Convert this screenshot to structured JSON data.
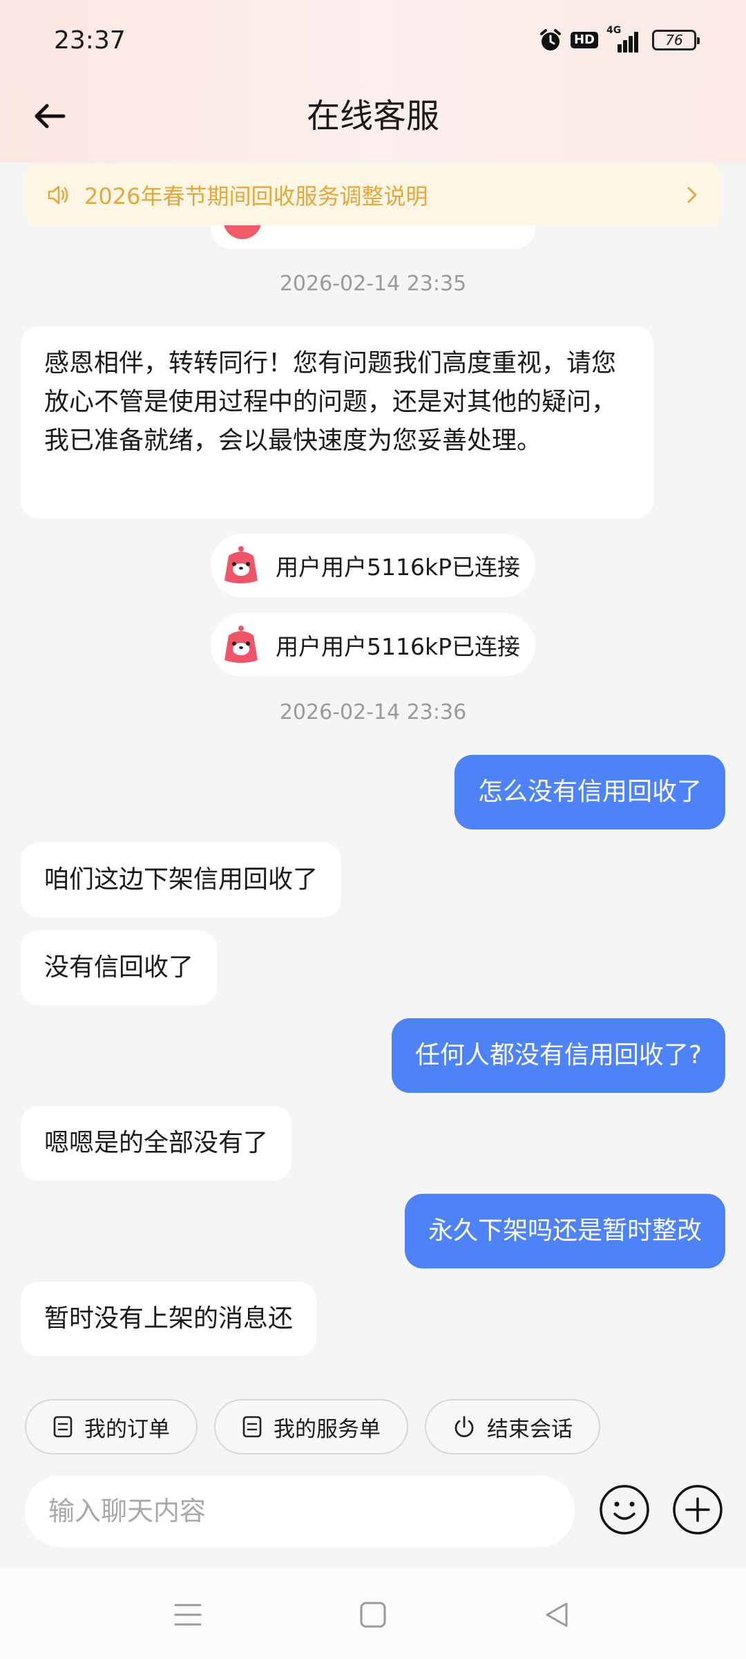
{
  "status_bar": {
    "time": "23:37",
    "hd": "HD",
    "network": "4G",
    "battery": "76"
  },
  "header": {
    "title": "在线客服",
    "back_icon": "arrow-left-icon"
  },
  "notice": {
    "text": "2026年春节期间回收服务调整说明",
    "icon": "speaker-icon"
  },
  "chat": {
    "timestamp_1": "2026-02-14 23:35",
    "agent_welcome": "感恩相伴，转转同行！您有问题我们高度重视，请您放心不管是使用过程中的问题，还是对其他的疑问，我已准备就绪，会以最快速度为您妥善处理。",
    "system_1": "用户用户5116kP已连接",
    "system_2": "用户用户5116kP已连接",
    "timestamp_2": "2026-02-14 23:36",
    "user_1": "怎么没有信用回收了",
    "agent_1": "咱们这边下架信用回收了",
    "agent_2": "没有信回收了",
    "user_2": "任何人都没有信用回收了?",
    "agent_3": "嗯嗯是的全部没有了",
    "user_3": "永久下架吗还是暂时整改",
    "agent_4": "暂时没有上架的消息还"
  },
  "quick_actions": [
    {
      "label": "我的订单",
      "icon": "document-icon"
    },
    {
      "label": "我的服务单",
      "icon": "document-icon"
    },
    {
      "label": "结束会话",
      "icon": "power-icon"
    }
  ],
  "composer": {
    "placeholder": "输入聊天内容",
    "emoji_icon": "emoji-icon",
    "add_icon": "plus-icon"
  },
  "colors": {
    "user_bubble": "#4d83f6",
    "notice_text": "#e5a63a",
    "notice_bg": "#fdf6e4",
    "header_bg": "#fde7e2"
  }
}
